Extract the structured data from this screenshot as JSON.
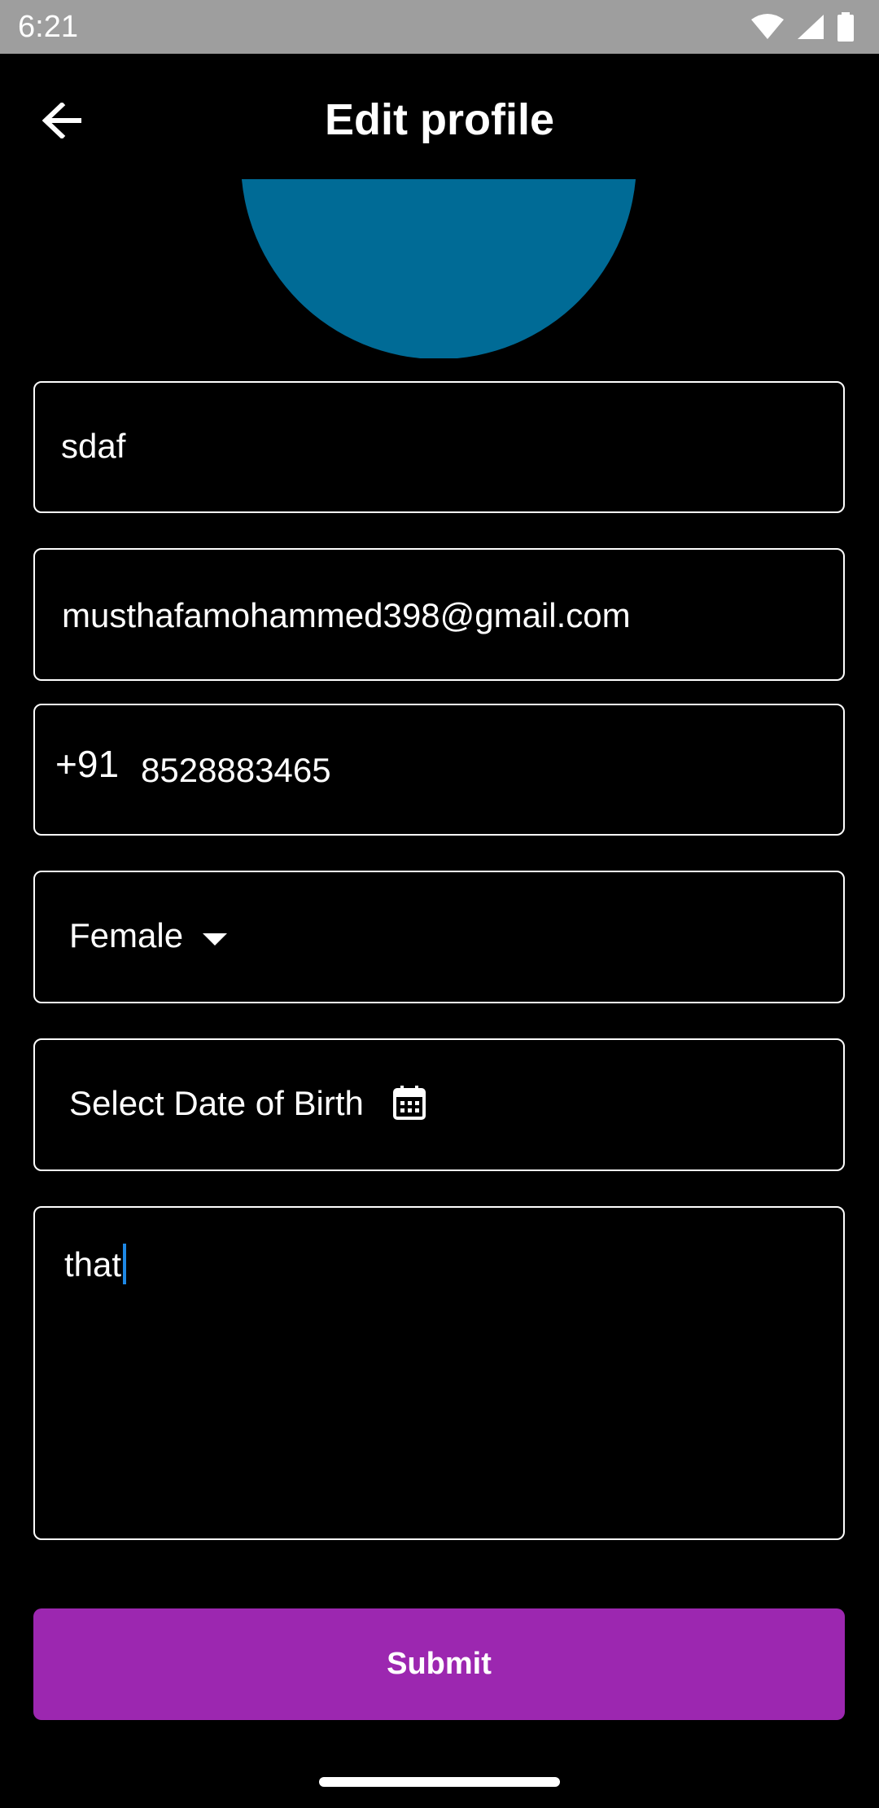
{
  "status_bar": {
    "time": "6:21",
    "icons": [
      "wifi-icon",
      "signal-icon",
      "battery-icon"
    ]
  },
  "app_bar": {
    "title": "Edit profile",
    "back_icon": "arrow-back-icon"
  },
  "avatar": {
    "color": "#006b96"
  },
  "form": {
    "name_value": "sdaf",
    "email_value": "musthafamohammed398@gmail.com",
    "phone_country_code": "+91",
    "phone_value": "8528883465",
    "gender_value": "Female",
    "dob_placeholder": "Select Date of Birth",
    "bio_value": "that"
  },
  "submit": {
    "label": "Submit",
    "color": "#9c27b0"
  }
}
